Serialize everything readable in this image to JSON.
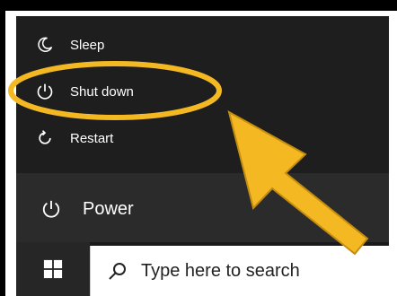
{
  "power_menu": {
    "items": [
      {
        "label": "Sleep",
        "icon": "sleep-icon"
      },
      {
        "label": "Shut down",
        "icon": "power-icon"
      },
      {
        "label": "Restart",
        "icon": "restart-icon"
      }
    ]
  },
  "start_menu": {
    "power_label": "Power",
    "power_icon": "power-icon"
  },
  "taskbar": {
    "start_icon": "windows-icon",
    "search_placeholder": "Type here to search",
    "search_icon": "search-icon"
  },
  "annotation": {
    "highlight_color": "#f4b823",
    "arrow_color": "#f4b823"
  }
}
